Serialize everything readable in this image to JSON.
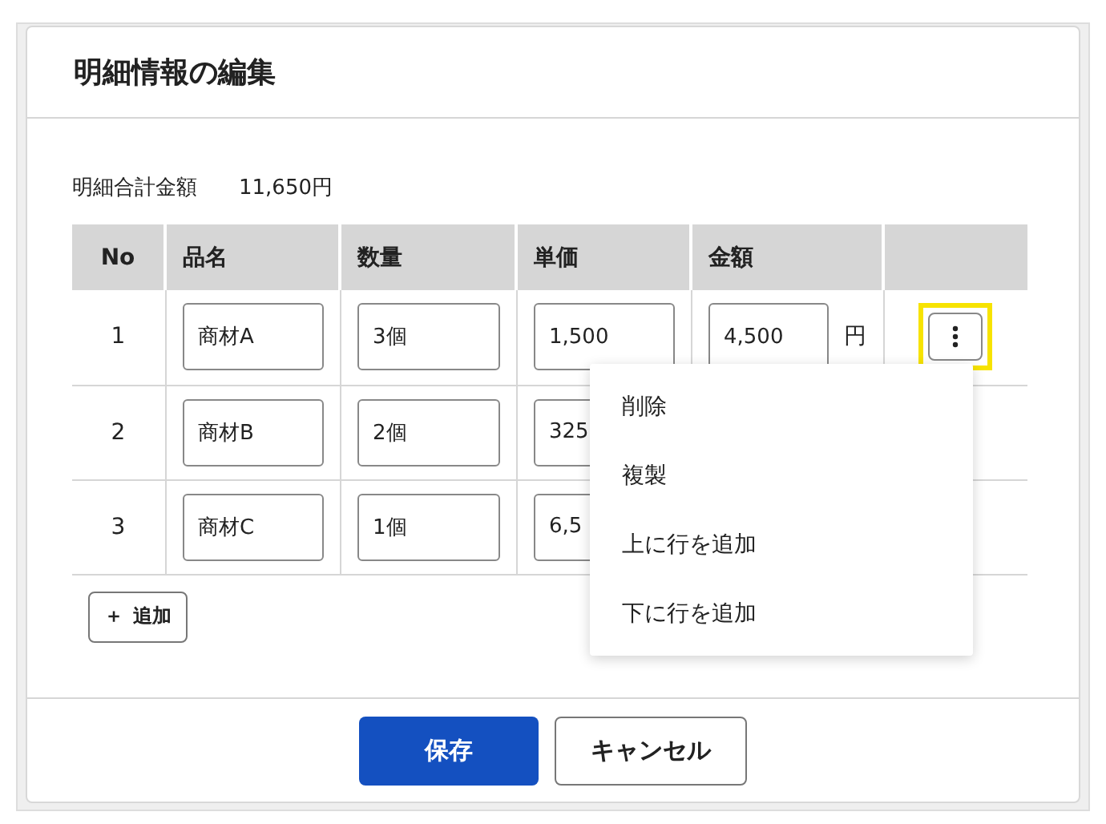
{
  "dialog": {
    "title": "明細情報の編集"
  },
  "summary": {
    "label": "明細合計金額",
    "value": "11,650円"
  },
  "table": {
    "columns": [
      "No",
      "品名",
      "数量",
      "単価",
      "金額"
    ],
    "rows": [
      {
        "no": "1",
        "name": "商材A",
        "quantity": "3個",
        "unit_price": "1,500",
        "amount": "4,500",
        "currency": "円",
        "menu_open": true
      },
      {
        "no": "2",
        "name": "商材B",
        "quantity": "2個",
        "unit_price": "325"
      },
      {
        "no": "3",
        "name": "商材C",
        "quantity": "1個",
        "unit_price": "6,5"
      }
    ]
  },
  "add_button": {
    "icon": "＋",
    "label": "追加"
  },
  "menu": {
    "items": [
      "削除",
      "複製",
      "上に行を追加",
      "下に行を追加"
    ]
  },
  "buttons": {
    "save": "保存",
    "cancel": "キャンセル"
  }
}
